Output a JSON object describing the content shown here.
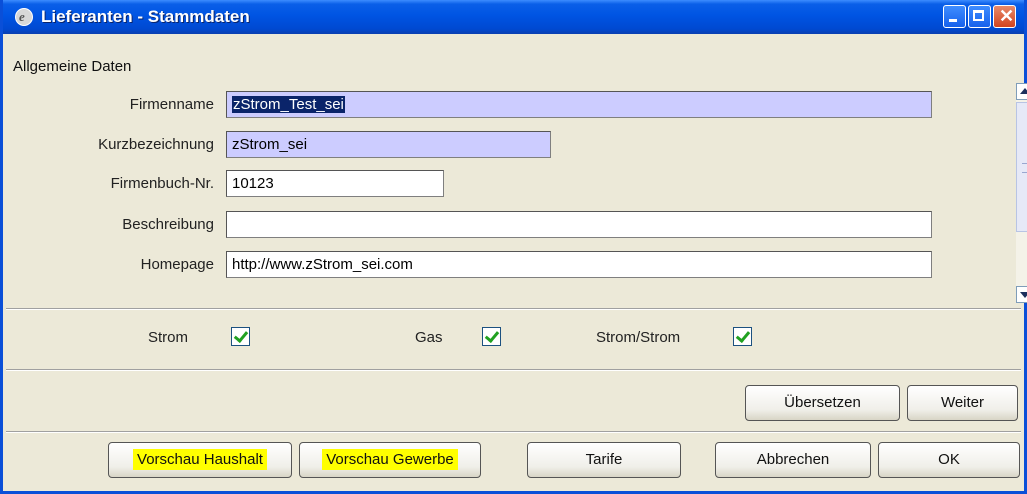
{
  "window": {
    "title": "Lieferanten - Stammdaten",
    "icon": "app-logo-icon",
    "controls": [
      "minimize-icon",
      "maximize-icon",
      "close-icon"
    ]
  },
  "section": {
    "title": "Allgemeine Daten"
  },
  "fields": {
    "firmenname": {
      "label": "Firmenname",
      "value": "zStrom_Test_sei"
    },
    "kurzbezeichnung": {
      "label": "Kurzbezeichnung",
      "value": "zStrom_sei"
    },
    "firmenbuch": {
      "label": "Firmenbuch-Nr.",
      "value": "10123"
    },
    "beschreibung": {
      "label": "Beschreibung",
      "value": ""
    },
    "homepage": {
      "label": "Homepage",
      "value": "http://www.zStrom_sei.com"
    }
  },
  "checkboxes": {
    "strom": {
      "label": "Strom",
      "checked": true
    },
    "gas": {
      "label": "Gas",
      "checked": true
    },
    "strom_strom": {
      "label": "Strom/Strom",
      "checked": true
    }
  },
  "actions": {
    "uebersetzen": "Übersetzen",
    "weiter": "Weiter"
  },
  "footer": {
    "vorschau_haushalt": "Vorschau Haushalt",
    "vorschau_gewerbe": "Vorschau Gewerbe",
    "tarife": "Tarife",
    "abbrechen": "Abbrechen",
    "ok": "OK"
  },
  "colors": {
    "titlebar": "#0054e3",
    "required_field": "#ccccff",
    "highlight": "#ffff00",
    "check": "#21a121"
  }
}
